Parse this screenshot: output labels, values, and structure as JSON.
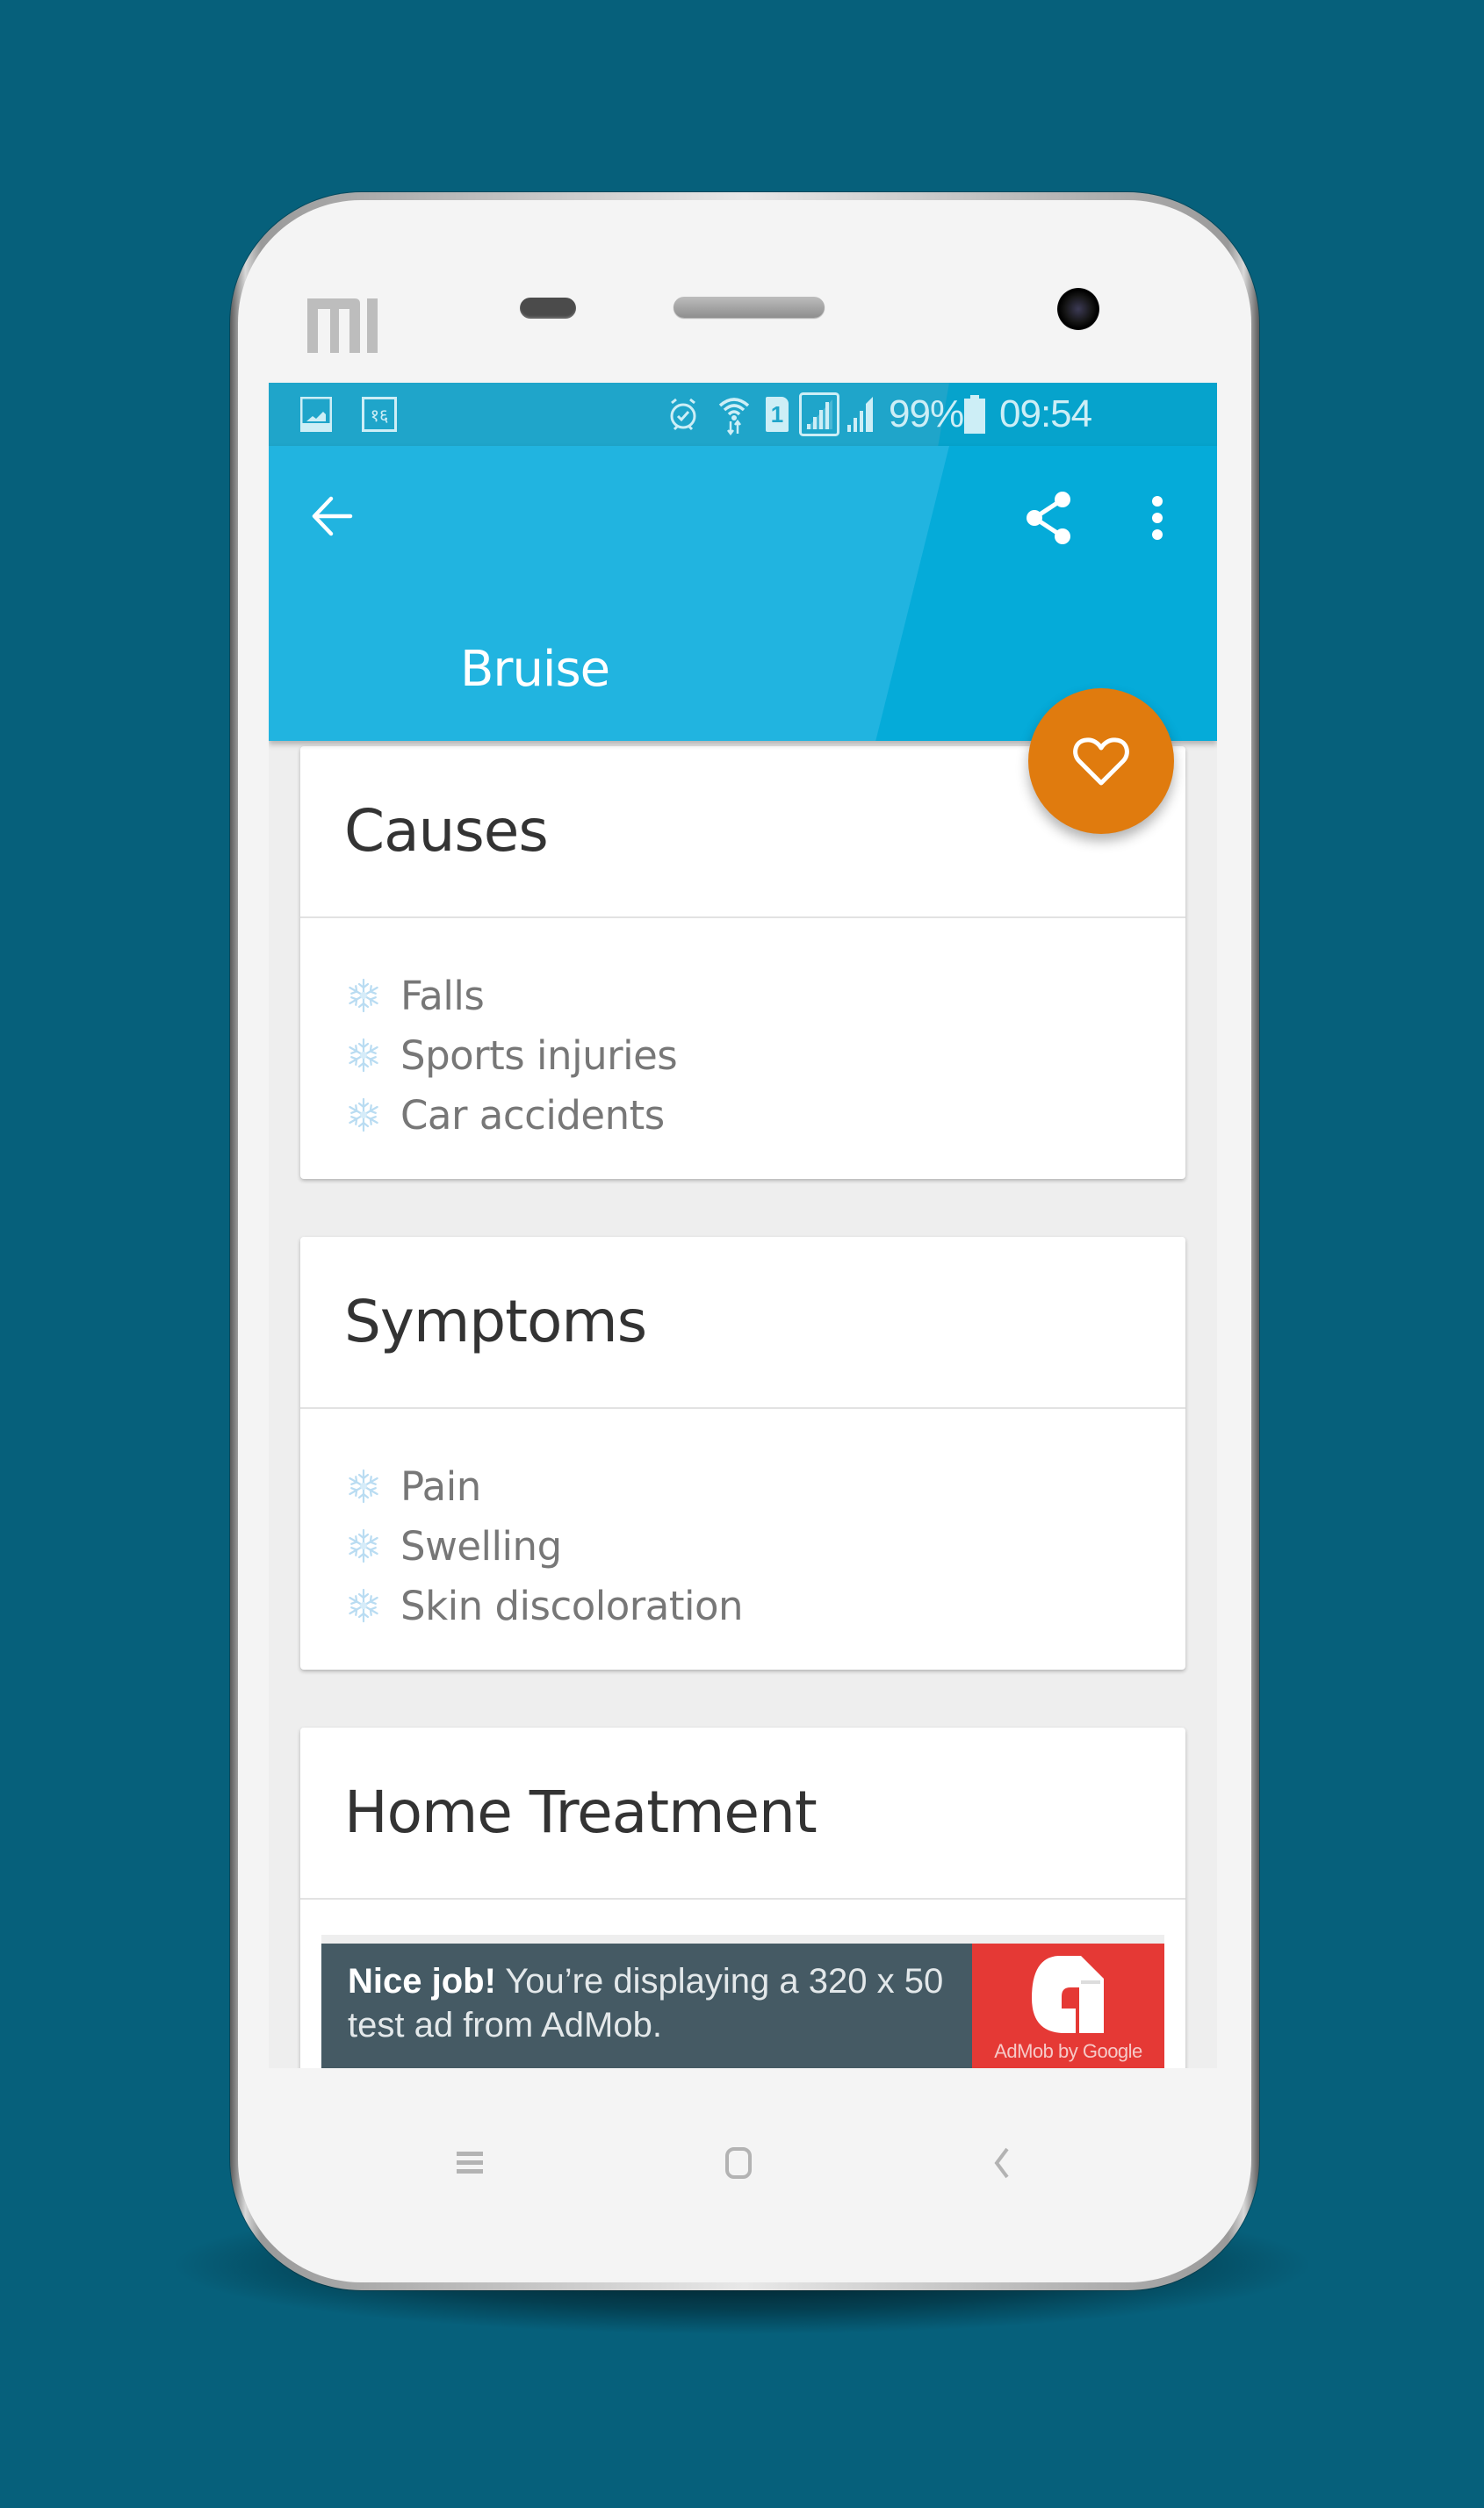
{
  "device": {
    "brand_logo": "MI"
  },
  "status_bar": {
    "left_icons": [
      "gallery-notification-icon",
      "devanagari-16-notification-icon"
    ],
    "devanagari_badge": "१६",
    "right_icons": [
      "alarm-icon",
      "wifi-icon",
      "sim-1-icon",
      "signal-sim1-icon",
      "signal-sim2-icon",
      "battery-icon"
    ],
    "sim_label": "1",
    "battery": "99%",
    "battery_level": 0.99,
    "time": "09:54"
  },
  "app_bar": {
    "title": "Bruise",
    "back_icon": "arrow-back-icon",
    "actions": [
      "share-icon",
      "more-vert-icon"
    ]
  },
  "fab": {
    "icon": "heart-outline-icon",
    "color": "#e07b0e"
  },
  "colors": {
    "primary": "#21b4e0",
    "status_bar": "#1fa5ca",
    "accent": "#e07b0e",
    "background": "#06607b"
  },
  "cards": [
    {
      "title": "Causes",
      "items": [
        "Falls",
        "Sports injuries",
        "Car accidents"
      ]
    },
    {
      "title": "Symptoms",
      "items": [
        "Pain",
        "Swelling",
        "Skin discoloration"
      ]
    },
    {
      "title": "Home Treatment",
      "items": []
    }
  ],
  "ad_banner": {
    "bold": "Nice job!",
    "line1_rest": " You’re displaying a 320 x 50",
    "line2": "test ad from AdMob.",
    "logo_caption": "AdMob by Google"
  },
  "nav_bar": {
    "buttons": [
      "menu-icon",
      "home-icon",
      "back-icon"
    ]
  }
}
